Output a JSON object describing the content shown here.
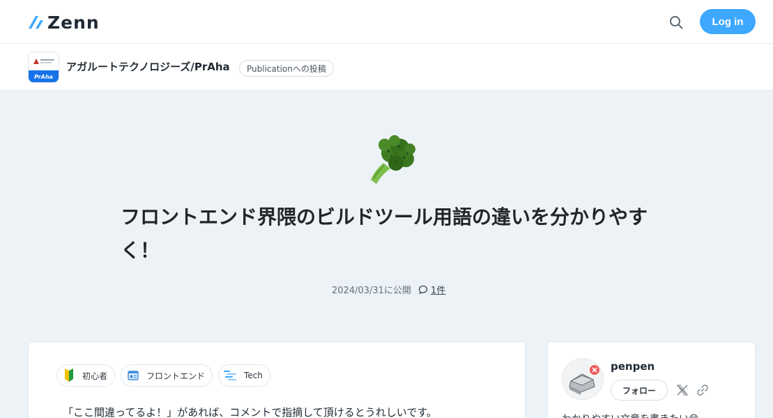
{
  "header": {
    "logo_text": "Zenn",
    "login_label": "Log in"
  },
  "publication": {
    "logo_label": "PrAha",
    "name": "アガルートテクノロジーズ/PrAha",
    "badge": "Publicationへの投稿"
  },
  "article": {
    "emoji": "broccoli",
    "title": "フロントエンド界隈のビルドツール用語の違いを分かりやすく！",
    "published": "2024/03/31に公開",
    "comment_count": "1件",
    "tags": [
      {
        "label": "初心者",
        "icon": "beginner-mark-icon"
      },
      {
        "label": "フロントエンド",
        "icon": "frontend-icon"
      },
      {
        "label": "Tech",
        "icon": "tech-icon"
      }
    ],
    "intro": "「ここ間違ってるよ！」があれば、コメントで指摘して頂けるとうれしいです。"
  },
  "author": {
    "name": "penpen",
    "follow_label": "フォロー",
    "bio": "わかりやすい文章を書きたい😄"
  },
  "colors": {
    "accent": "#3ea8ff",
    "background": "#edf2f7",
    "publication_blue": "#1673ea"
  }
}
